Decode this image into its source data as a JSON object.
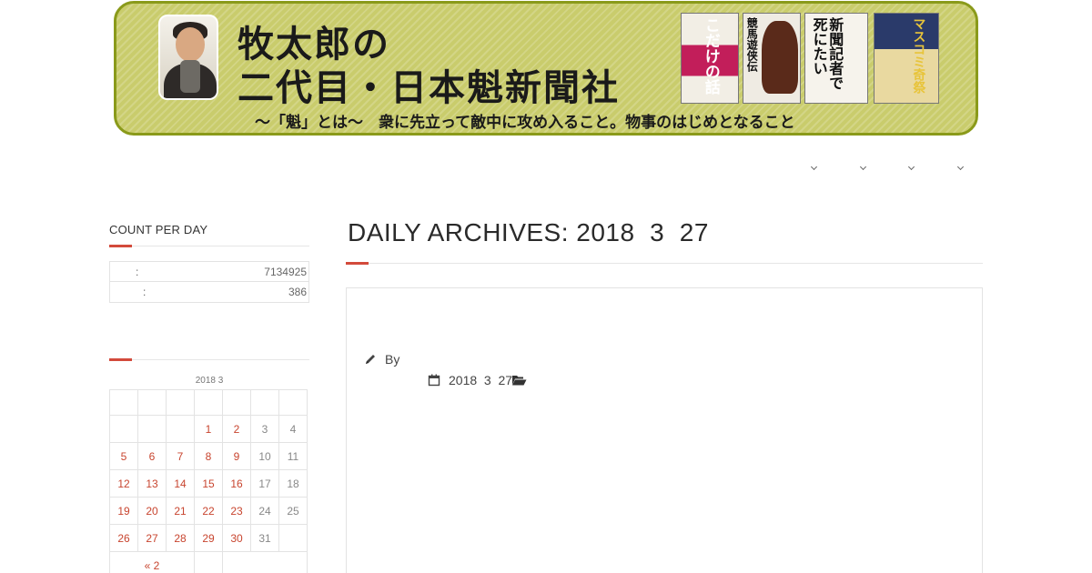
{
  "banner": {
    "title_line1": "牧太郎の",
    "title_line2": "二代目・日本魁新聞社",
    "tagline": "～「魁」とは～　衆に先立って敵中に攻め入ること。物事のはじめとなること",
    "books": [
      {
        "text": "こだけの話"
      },
      {
        "text": "競馬遊侠伝"
      },
      {
        "text": "新聞記者で死にたい"
      },
      {
        "text": "マスコミ奇祭"
      }
    ]
  },
  "nav": {
    "items": 4
  },
  "sidebar": {
    "count_widget": {
      "title": "COUNT PER DAY",
      "rows": [
        {
          "label": ":",
          "value": "7134925"
        },
        {
          "label": ":",
          "value": "386"
        }
      ]
    },
    "calendar": {
      "caption": "2018  3",
      "weeks": [
        [
          "",
          "",
          "",
          "1",
          "2",
          "3",
          "4"
        ],
        [
          "5",
          "6",
          "7",
          "8",
          "9",
          "10",
          "11"
        ],
        [
          "12",
          "13",
          "14",
          "15",
          "16",
          "17",
          "18"
        ],
        [
          "19",
          "20",
          "21",
          "22",
          "23",
          "24",
          "25"
        ],
        [
          "26",
          "27",
          "28",
          "29",
          "30",
          "31",
          ""
        ]
      ],
      "linked_days": [
        "1",
        "2",
        "5",
        "6",
        "7",
        "8",
        "9",
        "12",
        "13",
        "14",
        "15",
        "16",
        "19",
        "20",
        "21",
        "22",
        "23",
        "26",
        "27",
        "28",
        "29",
        "30"
      ],
      "prev_link": "« 2"
    }
  },
  "main": {
    "page_title": "DAILY ARCHIVES: 2018  3  27",
    "post": {
      "by_label": "By",
      "date": "2018  3  27"
    }
  },
  "colors": {
    "accent": "#d34a3b",
    "link": "#c8452f",
    "banner_bg": "#c9cc6c",
    "banner_border": "#8a9a1a"
  }
}
